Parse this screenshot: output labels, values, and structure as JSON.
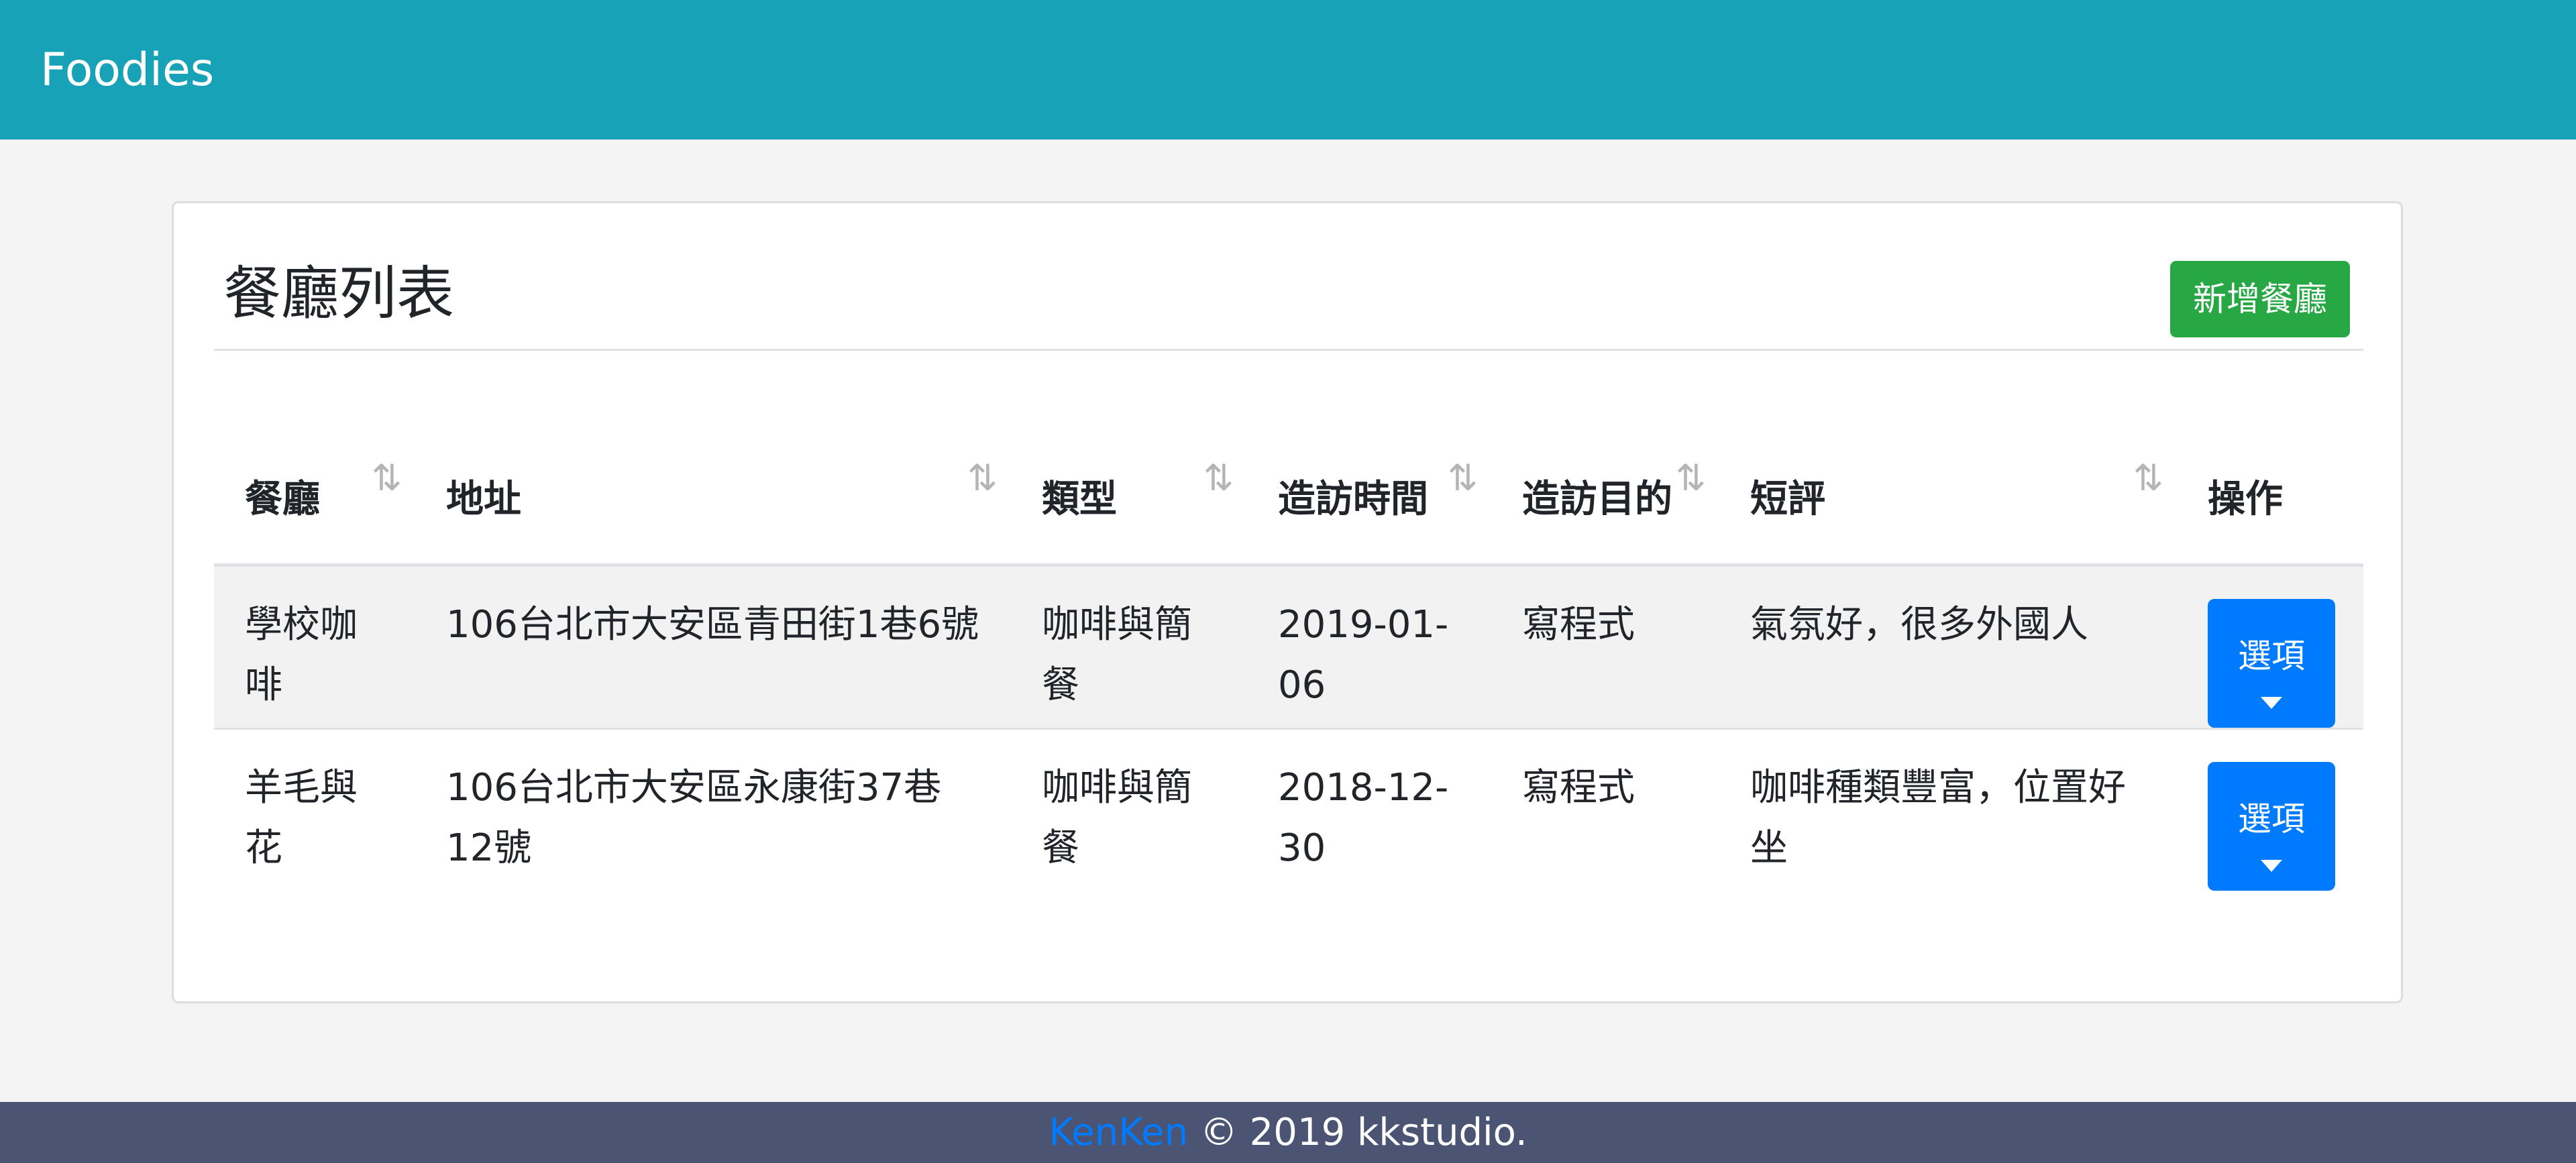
{
  "navbar": {
    "brand": "Foodies"
  },
  "card": {
    "title": "餐廳列表",
    "add_button_label": "新增餐廳"
  },
  "table": {
    "columns": [
      {
        "label": "餐廳",
        "sortable": true
      },
      {
        "label": "地址",
        "sortable": true
      },
      {
        "label": "類型",
        "sortable": true
      },
      {
        "label": "造訪時間",
        "sortable": true
      },
      {
        "label": "造訪目的",
        "sortable": true
      },
      {
        "label": "短評",
        "sortable": true
      },
      {
        "label": "操作",
        "sortable": false
      }
    ],
    "sort_icon": "⇅",
    "rows": [
      {
        "name": "學校咖啡",
        "address": "106台北市大安區青田街1巷6號",
        "type": "咖啡與簡餐",
        "visit_date": "2019-01-06",
        "purpose": "寫程式",
        "review": "氣氛好，很多外國人",
        "action_label": "選項"
      },
      {
        "name": "羊毛與花",
        "address": "106台北市大安區永康街37巷12號",
        "type": "咖啡與簡餐",
        "visit_date": "2018-12-30",
        "purpose": "寫程式",
        "review": "咖啡種類豐富，位置好坐",
        "action_label": "選項"
      }
    ]
  },
  "footer": {
    "author": "KenKen",
    "copyright": " © 2019 kkstudio."
  },
  "colors": {
    "navbar": "#18a2b8",
    "add_button": "#28a745",
    "options_button": "#007bff",
    "footer": "#4b5473"
  }
}
